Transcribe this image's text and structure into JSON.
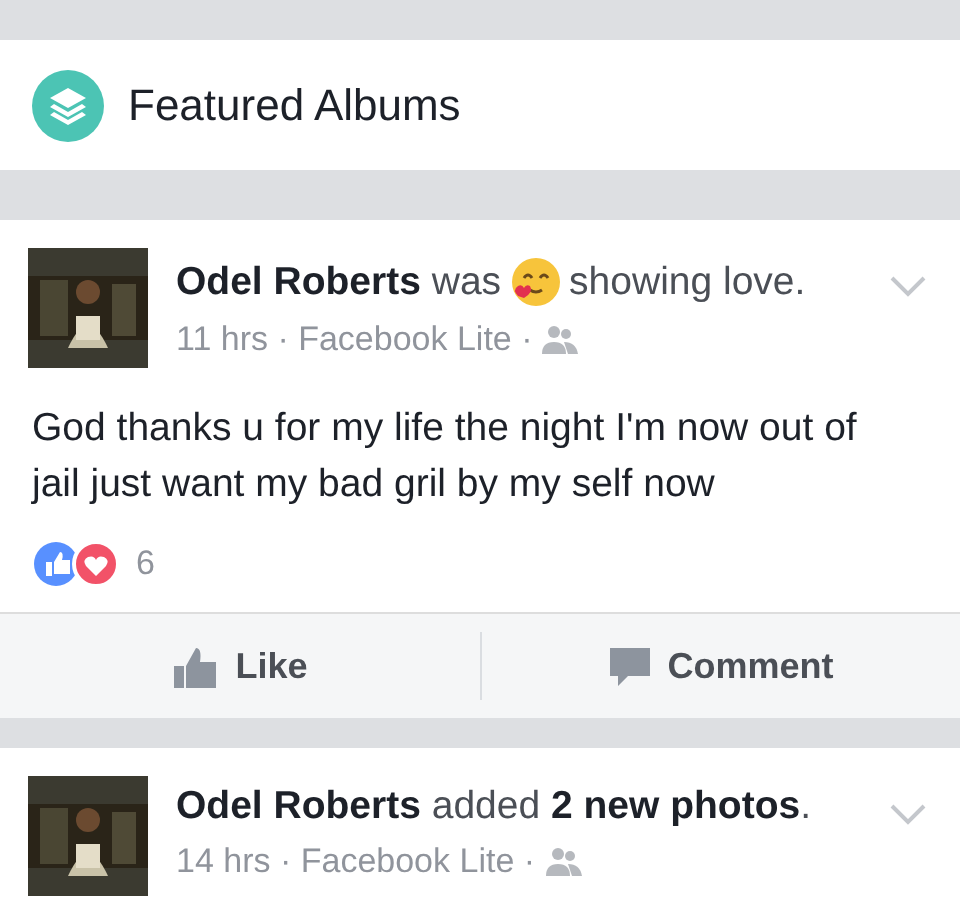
{
  "header": {
    "title": "Featured Albums"
  },
  "posts": [
    {
      "avatar": {
        "kind": "picture"
      },
      "headline": [
        {
          "kind": "text",
          "text": "**Odel Roberts** was"
        },
        {
          "kind": "emoji"
        },
        {
          "kind": "text",
          "text": "showing love."
        }
      ],
      "meta": "11 hrs · Facebook Lite ·",
      "body": "God thanks u for my life the night I'm now out of jail just want my bad gril by my self now",
      "reactions": {
        "count": "6"
      },
      "actions": [
        {
          "kind": "like",
          "label": "Like"
        },
        {
          "kind": "comment",
          "label": "Comment"
        }
      ]
    },
    {
      "avatar": {
        "kind": "picture"
      },
      "headline": [
        {
          "kind": "text",
          "text": "**Odel Roberts** added **2 new photos**."
        }
      ],
      "meta": "14 hrs · Facebook Lite ·"
    }
  ]
}
